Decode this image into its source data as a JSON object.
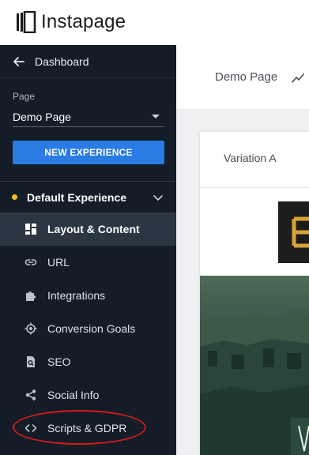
{
  "app": {
    "logo_text": "Instapage"
  },
  "sidebar": {
    "back_label": "Dashboard",
    "page_caption": "Page",
    "page_selected": "Demo Page",
    "new_experience_label": "NEW EXPERIENCE",
    "experience_label": "Default Experience",
    "items": [
      {
        "label": "Layout & Content",
        "icon": "layout-icon",
        "active": true
      },
      {
        "label": "URL",
        "icon": "link-icon",
        "active": false
      },
      {
        "label": "Integrations",
        "icon": "puzzle-icon",
        "active": false
      },
      {
        "label": "Conversion Goals",
        "icon": "target-icon",
        "active": false
      },
      {
        "label": "SEO",
        "icon": "seo-icon",
        "active": false
      },
      {
        "label": "Social Info",
        "icon": "share-icon",
        "active": false
      },
      {
        "label": "Scripts & GDPR",
        "icon": "code-icon",
        "active": false
      }
    ]
  },
  "main": {
    "breadcrumb": "Demo Page",
    "variation_label": "Variation A"
  },
  "colors": {
    "sidebar_bg": "#131c27",
    "accent_blue": "#2a7be4",
    "status_dot": "#f4c11a",
    "highlight": "#d51a1a"
  }
}
